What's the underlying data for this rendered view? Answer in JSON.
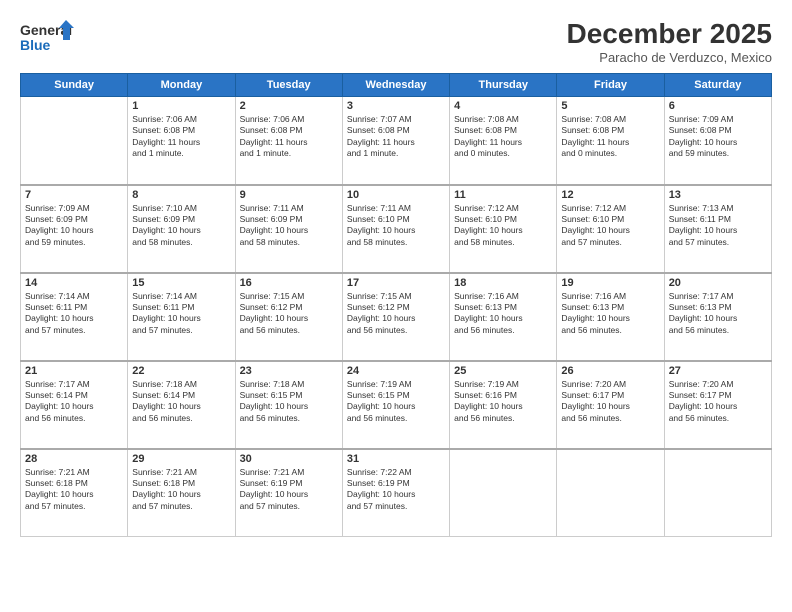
{
  "header": {
    "logo_line1": "General",
    "logo_line2": "Blue",
    "month": "December 2025",
    "location": "Paracho de Verduzco, Mexico"
  },
  "days_of_week": [
    "Sunday",
    "Monday",
    "Tuesday",
    "Wednesday",
    "Thursday",
    "Friday",
    "Saturday"
  ],
  "weeks": [
    [
      {
        "num": "",
        "info": ""
      },
      {
        "num": "1",
        "info": "Sunrise: 7:06 AM\nSunset: 6:08 PM\nDaylight: 11 hours\nand 1 minute."
      },
      {
        "num": "2",
        "info": "Sunrise: 7:06 AM\nSunset: 6:08 PM\nDaylight: 11 hours\nand 1 minute."
      },
      {
        "num": "3",
        "info": "Sunrise: 7:07 AM\nSunset: 6:08 PM\nDaylight: 11 hours\nand 1 minute."
      },
      {
        "num": "4",
        "info": "Sunrise: 7:08 AM\nSunset: 6:08 PM\nDaylight: 11 hours\nand 0 minutes."
      },
      {
        "num": "5",
        "info": "Sunrise: 7:08 AM\nSunset: 6:08 PM\nDaylight: 11 hours\nand 0 minutes."
      },
      {
        "num": "6",
        "info": "Sunrise: 7:09 AM\nSunset: 6:08 PM\nDaylight: 10 hours\nand 59 minutes."
      }
    ],
    [
      {
        "num": "7",
        "info": "Sunrise: 7:09 AM\nSunset: 6:09 PM\nDaylight: 10 hours\nand 59 minutes."
      },
      {
        "num": "8",
        "info": "Sunrise: 7:10 AM\nSunset: 6:09 PM\nDaylight: 10 hours\nand 58 minutes."
      },
      {
        "num": "9",
        "info": "Sunrise: 7:11 AM\nSunset: 6:09 PM\nDaylight: 10 hours\nand 58 minutes."
      },
      {
        "num": "10",
        "info": "Sunrise: 7:11 AM\nSunset: 6:10 PM\nDaylight: 10 hours\nand 58 minutes."
      },
      {
        "num": "11",
        "info": "Sunrise: 7:12 AM\nSunset: 6:10 PM\nDaylight: 10 hours\nand 58 minutes."
      },
      {
        "num": "12",
        "info": "Sunrise: 7:12 AM\nSunset: 6:10 PM\nDaylight: 10 hours\nand 57 minutes."
      },
      {
        "num": "13",
        "info": "Sunrise: 7:13 AM\nSunset: 6:11 PM\nDaylight: 10 hours\nand 57 minutes."
      }
    ],
    [
      {
        "num": "14",
        "info": "Sunrise: 7:14 AM\nSunset: 6:11 PM\nDaylight: 10 hours\nand 57 minutes."
      },
      {
        "num": "15",
        "info": "Sunrise: 7:14 AM\nSunset: 6:11 PM\nDaylight: 10 hours\nand 57 minutes."
      },
      {
        "num": "16",
        "info": "Sunrise: 7:15 AM\nSunset: 6:12 PM\nDaylight: 10 hours\nand 56 minutes."
      },
      {
        "num": "17",
        "info": "Sunrise: 7:15 AM\nSunset: 6:12 PM\nDaylight: 10 hours\nand 56 minutes."
      },
      {
        "num": "18",
        "info": "Sunrise: 7:16 AM\nSunset: 6:13 PM\nDaylight: 10 hours\nand 56 minutes."
      },
      {
        "num": "19",
        "info": "Sunrise: 7:16 AM\nSunset: 6:13 PM\nDaylight: 10 hours\nand 56 minutes."
      },
      {
        "num": "20",
        "info": "Sunrise: 7:17 AM\nSunset: 6:13 PM\nDaylight: 10 hours\nand 56 minutes."
      }
    ],
    [
      {
        "num": "21",
        "info": "Sunrise: 7:17 AM\nSunset: 6:14 PM\nDaylight: 10 hours\nand 56 minutes."
      },
      {
        "num": "22",
        "info": "Sunrise: 7:18 AM\nSunset: 6:14 PM\nDaylight: 10 hours\nand 56 minutes."
      },
      {
        "num": "23",
        "info": "Sunrise: 7:18 AM\nSunset: 6:15 PM\nDaylight: 10 hours\nand 56 minutes."
      },
      {
        "num": "24",
        "info": "Sunrise: 7:19 AM\nSunset: 6:15 PM\nDaylight: 10 hours\nand 56 minutes."
      },
      {
        "num": "25",
        "info": "Sunrise: 7:19 AM\nSunset: 6:16 PM\nDaylight: 10 hours\nand 56 minutes."
      },
      {
        "num": "26",
        "info": "Sunrise: 7:20 AM\nSunset: 6:17 PM\nDaylight: 10 hours\nand 56 minutes."
      },
      {
        "num": "27",
        "info": "Sunrise: 7:20 AM\nSunset: 6:17 PM\nDaylight: 10 hours\nand 56 minutes."
      }
    ],
    [
      {
        "num": "28",
        "info": "Sunrise: 7:21 AM\nSunset: 6:18 PM\nDaylight: 10 hours\nand 57 minutes."
      },
      {
        "num": "29",
        "info": "Sunrise: 7:21 AM\nSunset: 6:18 PM\nDaylight: 10 hours\nand 57 minutes."
      },
      {
        "num": "30",
        "info": "Sunrise: 7:21 AM\nSunset: 6:19 PM\nDaylight: 10 hours\nand 57 minutes."
      },
      {
        "num": "31",
        "info": "Sunrise: 7:22 AM\nSunset: 6:19 PM\nDaylight: 10 hours\nand 57 minutes."
      },
      {
        "num": "",
        "info": ""
      },
      {
        "num": "",
        "info": ""
      },
      {
        "num": "",
        "info": ""
      }
    ]
  ]
}
